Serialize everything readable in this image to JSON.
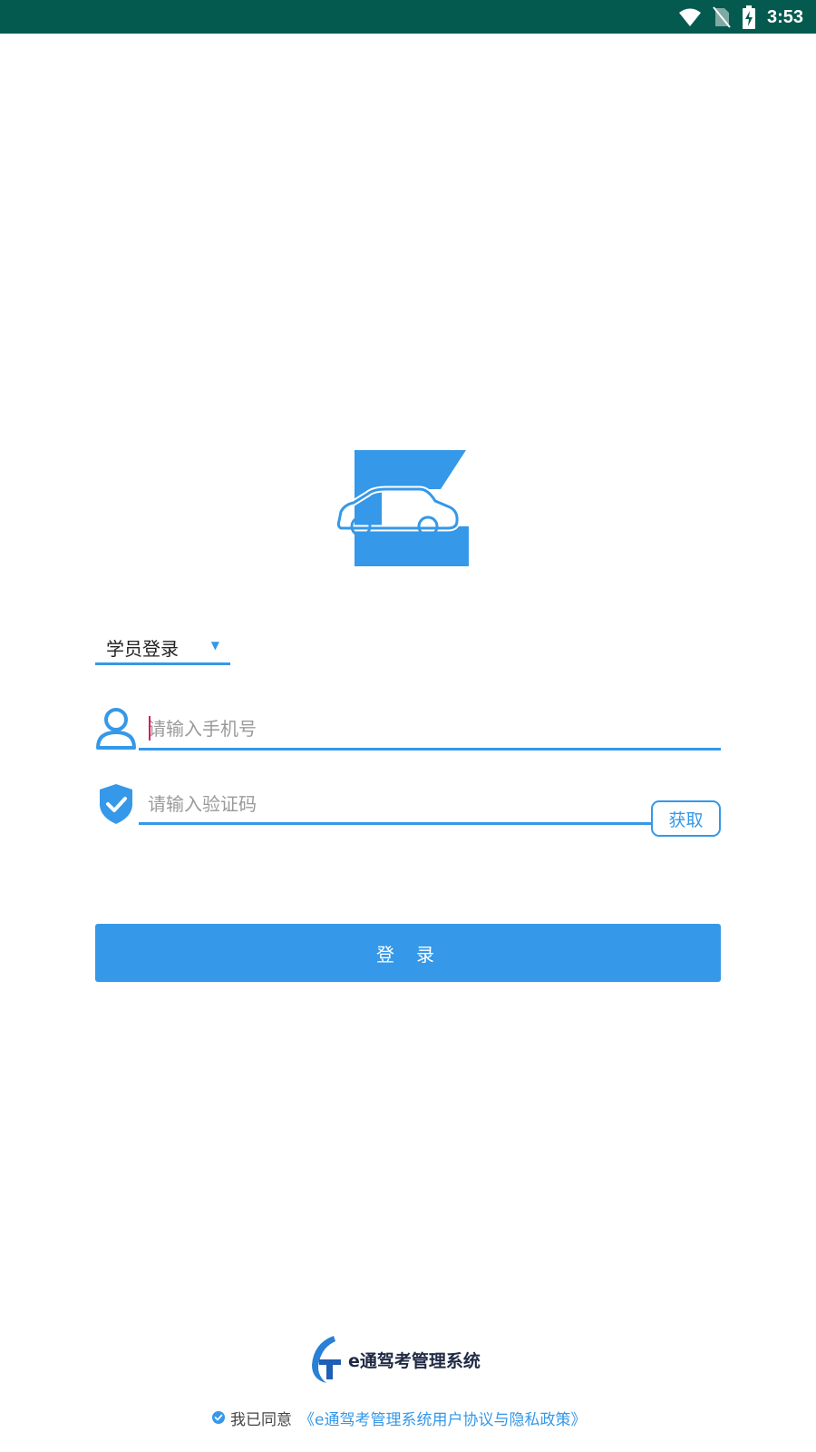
{
  "status_bar": {
    "time": "3:53",
    "icons": [
      "wifi-icon",
      "no-sim-icon",
      "battery-charging-icon"
    ]
  },
  "colors": {
    "status_bar_bg": "#045a4f",
    "accent": "#3598e8",
    "cursor": "#d81b60",
    "brand_text": "#1f2a44"
  },
  "logo": {
    "icon": "e-car-logo-icon"
  },
  "role_select": {
    "selected": "学员登录",
    "arrow": "▼"
  },
  "phone_field": {
    "placeholder": "请输入手机号",
    "value": "",
    "icon": "user-icon"
  },
  "code_field": {
    "placeholder": "请输入验证码",
    "value": "",
    "icon": "shield-check-icon"
  },
  "get_code_button": {
    "label": "获取"
  },
  "login_button": {
    "label": "登录"
  },
  "brand": {
    "name": "e通驾考管理系统",
    "icon": "et-brand-logo-icon"
  },
  "agreement": {
    "text": "我已同意",
    "link": "《e通驾考管理系统用户协议与隐私政策》",
    "checked": true
  }
}
